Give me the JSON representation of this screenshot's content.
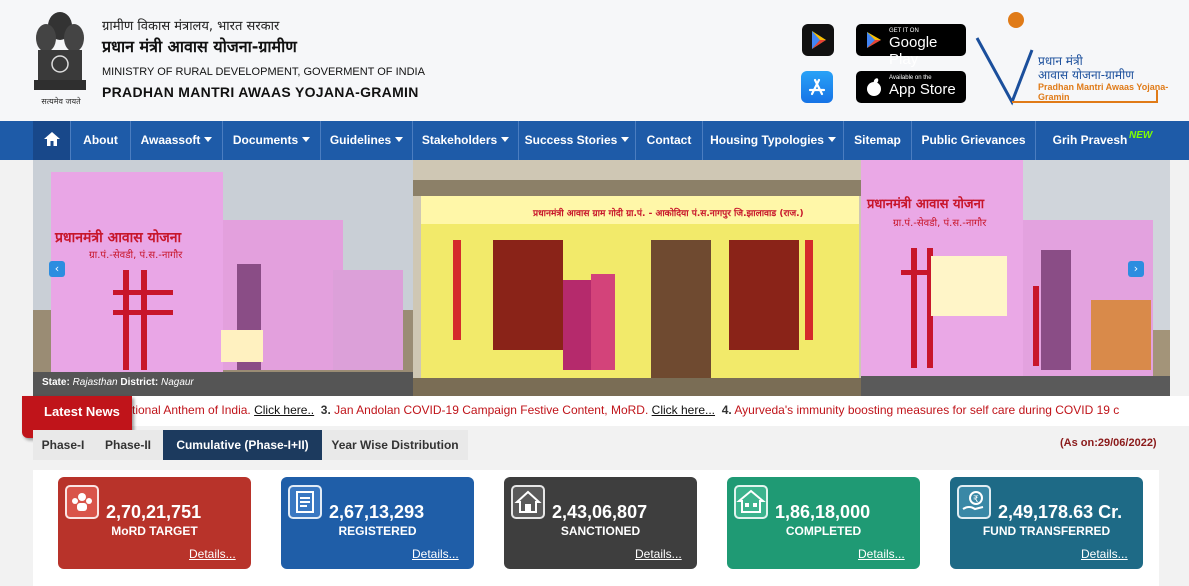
{
  "header": {
    "hindi_ministry": "ग्रामीण विकास मंत्रालय, भारत सरकार",
    "hindi_scheme": "प्रधान मंत्री आवास योजना-ग्रामीण",
    "ministry": "MINISTRY OF RURAL DEVELOPMENT, GOVERMENT OF INDIA",
    "scheme": "PRADHAN MANTRI AWAAS YOJANA-GRAMIN",
    "motto": "सत्यमेव जयते",
    "google_small": "GET IT ON",
    "google_big": "Google Play",
    "apple_small": "Available on the",
    "apple_big": "App Store",
    "logo_hindi1": "प्रधान मंत्री",
    "logo_hindi2": "आवास योजना-ग्रामीण",
    "logo_eng": "Pradhan Mantri Awaas Yojana-Gramin"
  },
  "nav": {
    "items": [
      "About",
      "Awaassoft",
      "Documents",
      "Guidelines",
      "Stakeholders",
      "Success Stories",
      "Contact",
      "Housing Typologies",
      "Sitemap",
      "Public Grievances",
      "Grih Pravesh"
    ],
    "new_badge": "NEW"
  },
  "carousel": {
    "state_label": "State:",
    "state": "Rajasthan",
    "district_label": "District:",
    "district": "Nagaur",
    "sign_left": "प्रधानमंत्री आवास योजना",
    "sign_left2": "ग्रा.पं.-सेवडी, पं.स.-नागौर",
    "sign_right": "प्रधानमंत्री आवास योजना",
    "sign_right2": "ग्रा.पं.-सेवडी, पं.स.-नागौर",
    "sign_center": "प्रधानमंत्री आवास ग्राम गोदी ग्रा.पं. - आकोदिया पं.स.नागपुर जि.झालावाड (राज.)"
  },
  "news": {
    "label": "Latest News",
    "items": [
      {
        "num": "",
        "text": "tional Anthem of India.",
        "link": "Click here.."
      },
      {
        "num": "3.",
        "text": "Jan Andolan COVID-19 Campaign Festive Content, MoRD.",
        "link": "Click here..."
      },
      {
        "num": "4.",
        "text": "Ayurveda's immunity boosting measures for self care during COVID 19 c",
        "link": ""
      }
    ]
  },
  "tabs": {
    "items": [
      "Phase-I",
      "Phase-II",
      "Cumulative (Phase-I+II)",
      "Year Wise Distribution"
    ],
    "active": "Cumulative (Phase-I+II)",
    "as_on": "(As on:29/06/2022)"
  },
  "stats": [
    {
      "value": "2,70,21,751",
      "label": "MoRD TARGET",
      "details": "Details...",
      "color": "#b8332a",
      "icon": "target-people-icon"
    },
    {
      "value": "2,67,13,293",
      "label": "REGISTERED",
      "details": "Details...",
      "color": "#1f5ea8",
      "icon": "registered-form-icon"
    },
    {
      "value": "2,43,06,807",
      "label": "SANCTIONED",
      "details": "Details...",
      "color": "#3e3e3e",
      "icon": "house-icon"
    },
    {
      "value": "1,86,18,000",
      "label": "COMPLETED",
      "details": "Details...",
      "color": "#1f9a74",
      "icon": "completed-house-icon"
    },
    {
      "value": "2,49,178.63 Cr.",
      "label": "FUND TRANSFERRED",
      "details": "Details...",
      "color": "#1e6a86",
      "icon": "fund-hand-icon"
    }
  ]
}
